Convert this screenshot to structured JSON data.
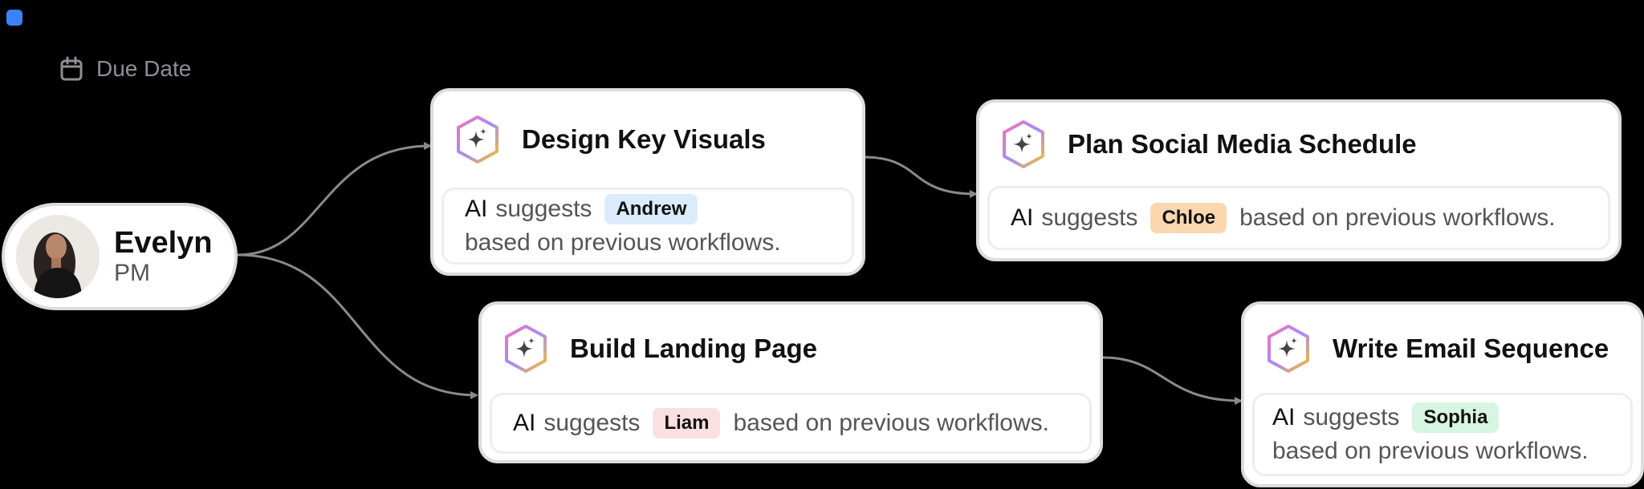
{
  "due_date": {
    "label": "Due Date",
    "icon": "calendar-icon"
  },
  "person": {
    "name": "Evelyn",
    "role": "PM",
    "avatar": "avatar-photo"
  },
  "ai_prefix": "AI",
  "suggests_text": "suggests",
  "based_text": "based on previous workflows.",
  "colors": {
    "background": "#000000",
    "card": "#FFFFFF",
    "connector": "#8A8A8A",
    "accent_blue": "#3B82F6"
  },
  "tasks": [
    {
      "title": "Design Key Visuals",
      "assignee": "Andrew",
      "chip_color": "#DCEBFB",
      "icon": "ai-sparkle-icon"
    },
    {
      "title": "Plan Social Media Schedule",
      "assignee": "Chloe",
      "chip_color": "#FBD7B0",
      "icon": "ai-sparkle-icon"
    },
    {
      "title": "Build Landing Page",
      "assignee": "Liam",
      "chip_color": "#FBE0E2",
      "icon": "ai-sparkle-icon"
    },
    {
      "title": "Write Email Sequence",
      "assignee": "Sophia",
      "chip_color": "#D7F5E3",
      "icon": "ai-sparkle-icon"
    }
  ]
}
